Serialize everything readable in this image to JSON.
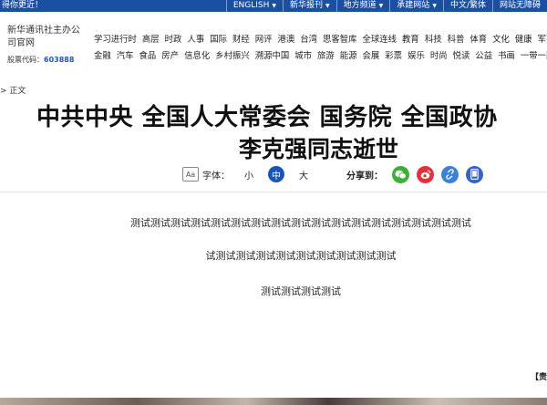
{
  "topbar": {
    "greeting": "得你更近！",
    "links": [
      {
        "label": "ENGLISH",
        "dropdown": true
      },
      {
        "label": "新华报刊",
        "dropdown": true
      },
      {
        "label": "地方频道",
        "dropdown": true
      },
      {
        "label": "承建网站",
        "dropdown": true
      },
      {
        "label": "中文/繁体",
        "dropdown": false
      },
      {
        "label": "网站无障碍",
        "dropdown": false
      }
    ]
  },
  "brand": {
    "name": "新华通讯社主办公司官网",
    "stock_label": "股票代码：",
    "stock_code": "603888"
  },
  "nav": {
    "row1": [
      "学习进行时",
      "高层",
      "时政",
      "人事",
      "国际",
      "财经",
      "网评",
      "港澳",
      "台湾",
      "思客智库",
      "全球连线",
      "教育",
      "科技",
      "科普",
      "体育",
      "文化",
      "健康",
      "军事"
    ],
    "row2": [
      "金融",
      "汽车",
      "食品",
      "房产",
      "信息化",
      "乡村振兴",
      "溯源中国",
      "城市",
      "旅游",
      "能源",
      "会展",
      "彩票",
      "娱乐",
      "时尚",
      "悦读",
      "公益",
      "书画",
      "一带一路"
    ]
  },
  "breadcrumb": "> 正文",
  "article": {
    "title_line1": "中共中央 全国人大常委会 国务院 全国政协",
    "title_line2": "李克强同志逝世",
    "paragraphs": [
      "测试测试测试测试测试测试测试测试测试测试测试测试测试测试测试测试测试",
      "试测试测试测试测试测试测试测试测试测试",
      "测试测试测试测试"
    ],
    "editor": "【责任编辑"
  },
  "tools": {
    "font_label": "字体：",
    "sizes": [
      "小",
      "中",
      "大"
    ],
    "active_size": "中",
    "share_label": "分享到："
  },
  "colors": {
    "topbar": "#1a4fa3",
    "accent": "#1a56b8",
    "wechat": "#3cb034",
    "weibo": "#e0323c",
    "link": "#3a82d9",
    "mobile": "#3662c9"
  }
}
